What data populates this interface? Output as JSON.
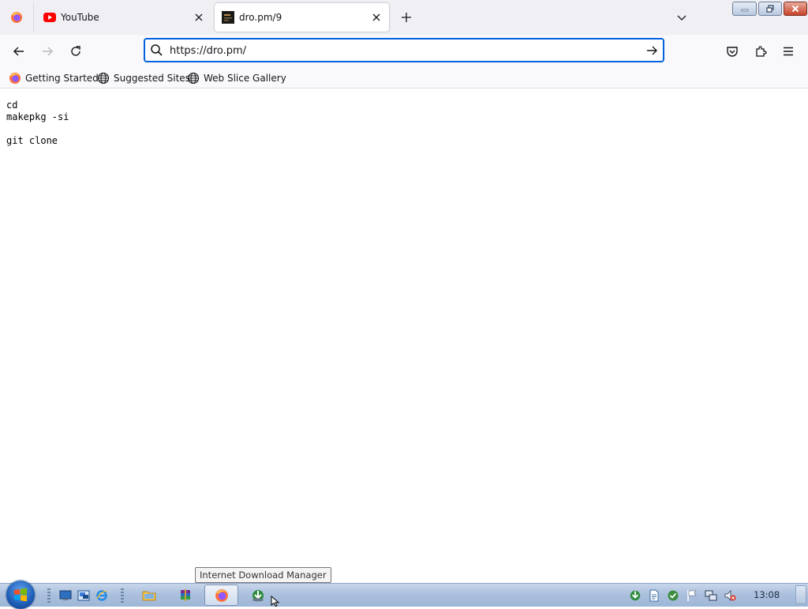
{
  "browser": {
    "tabs": [
      {
        "title": "YouTube",
        "favicon": "youtube-icon",
        "active": false
      },
      {
        "title": "dro.pm/9",
        "favicon": "site-icon",
        "active": true
      }
    ],
    "url": "https://dro.pm/",
    "bookmarks": [
      {
        "label": "Getting Started",
        "icon": "firefox-icon"
      },
      {
        "label": "Suggested Sites",
        "icon": "globe-icon"
      },
      {
        "label": "Web Slice Gallery",
        "icon": "globe-icon"
      }
    ]
  },
  "page": {
    "lines": [
      "cd",
      "makepkg -si",
      "",
      "git clone"
    ]
  },
  "tooltip": {
    "text": "Internet Download Manager"
  },
  "taskbar": {
    "clock": "13:08"
  },
  "colors": {
    "accent": "#0061e0",
    "tab_bg": "#f0f0f4",
    "toolbar_bg": "#f9f9fb",
    "youtube_red": "#ff0000",
    "taskbar": "#a9bfdc"
  }
}
